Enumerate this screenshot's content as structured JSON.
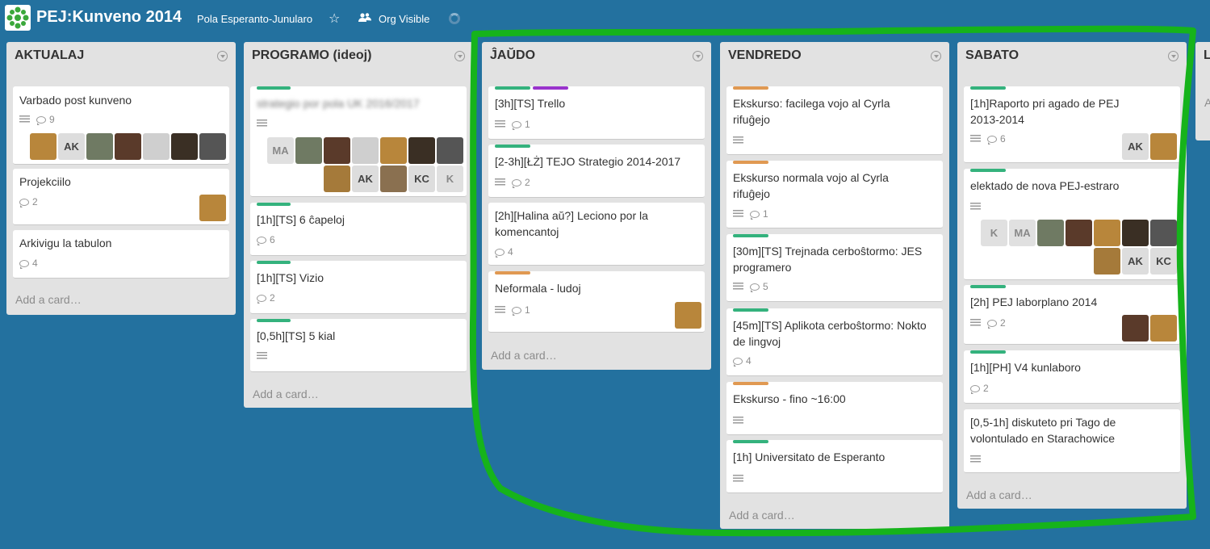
{
  "header": {
    "board_title": "PEJ:Kunveno 2014",
    "org_name": "Pola Esperanto-Junularo",
    "visibility": "Org Visible"
  },
  "colors": {
    "background": "#23719f",
    "label_green": "#34b27d",
    "label_purple": "#9933cc",
    "label_orange": "#e09952",
    "annotation": "#16b31b"
  },
  "lists": [
    {
      "title": "AKTUALAJ",
      "add_card": "Add a card…",
      "cards": [
        {
          "title": "Varbado post kunveno",
          "comments": "9",
          "members": [
            "",
            "AK",
            "",
            "",
            "",
            "",
            ""
          ]
        },
        {
          "title": "Projekciilo",
          "comments": "2",
          "members": [
            ""
          ]
        },
        {
          "title": "Arkivigu la tabulon",
          "comments": "4"
        }
      ]
    },
    {
      "title": "PROGRAMO (ideoj)",
      "add_card": "Add a card…",
      "cards": [
        {
          "title": "strategio por pola UK 2016/2017",
          "members": [
            "MA",
            "",
            "",
            "",
            "",
            "",
            "",
            "",
            "AK",
            "",
            "KC",
            "K"
          ]
        },
        {
          "title": "[1h][TS] 6 ĉapeloj",
          "comments": "6"
        },
        {
          "title": "[1h][TS] Vizio",
          "comments": "2"
        },
        {
          "title": "[0,5h][TS] 5 kial"
        }
      ]
    },
    {
      "title": "ĴAŬDO",
      "add_card": "Add a card…",
      "cards": [
        {
          "title": "[3h][TS] Trello",
          "comments": "1"
        },
        {
          "title": "[2-3h][ŁŻ] TEJO Strategio 2014-2017",
          "comments": "2"
        },
        {
          "title": "[2h][Halina aŭ?] Leciono por la komencantoj",
          "comments": "4"
        },
        {
          "title": "Neformala - ludoj",
          "comments": "1",
          "members": [
            ""
          ]
        }
      ]
    },
    {
      "title": "VENDREDO",
      "add_card": "Add a card…",
      "cards": [
        {
          "title": "Ekskurso: facilega vojo al Cyrla rifuĝejo"
        },
        {
          "title": "Ekskurso normala vojo al Cyrla rifuĝejo",
          "comments": "1"
        },
        {
          "title": "[30m][TS] Trejnada cerboŝtormo: JES programero",
          "comments": "5"
        },
        {
          "title": "[45m][TS] Aplikota cerboŝtormo: Nokto de lingvoj",
          "comments": "4"
        },
        {
          "title": "Ekskurso - fino ~16:00"
        },
        {
          "title": "[1h] Universitato de Esperanto"
        }
      ]
    },
    {
      "title": "SABATO",
      "add_card": "Add a card…",
      "cards": [
        {
          "title": "[1h]Raporto pri agado de PEJ 2013-2014",
          "comments": "6",
          "members": [
            "AK",
            ""
          ]
        },
        {
          "title": "elektado de nova PEJ-estraro",
          "members": [
            "K",
            "MA",
            "",
            "",
            "",
            "",
            "",
            "",
            "AK",
            "KC"
          ]
        },
        {
          "title": "[2h] PEJ laborplano 2014",
          "comments": "2",
          "members": [
            "",
            ""
          ]
        },
        {
          "title": "[1h][PH] V4 kunlaboro",
          "comments": "2"
        },
        {
          "title": "[0,5-1h] diskuteto pri Tago de volontulado en Starachowice"
        }
      ]
    },
    {
      "title": "L",
      "add_card": "A"
    }
  ]
}
